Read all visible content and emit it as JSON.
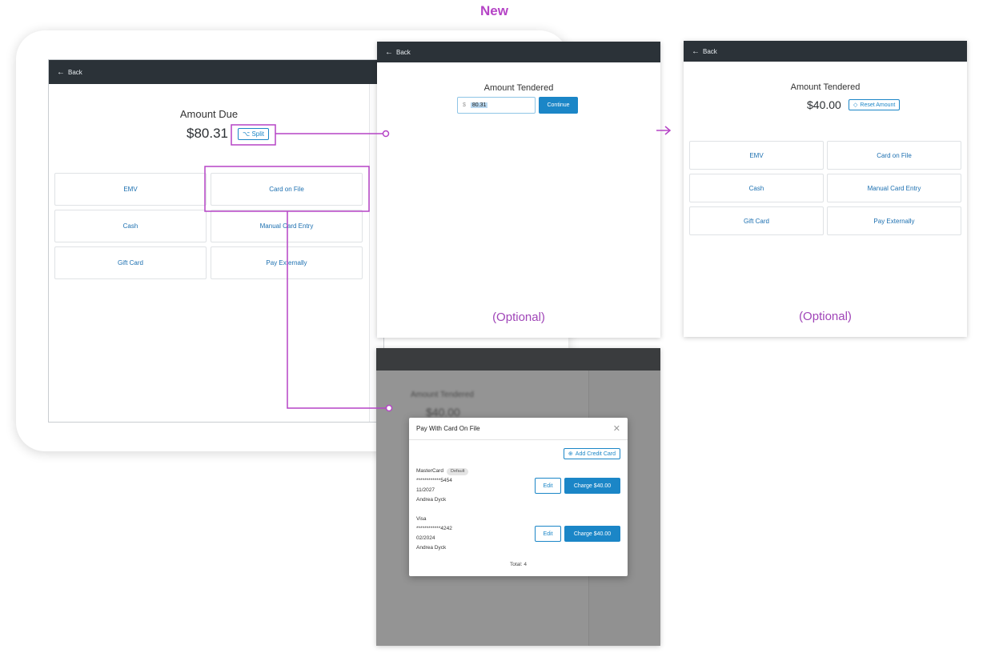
{
  "header": {
    "title": "New"
  },
  "colors": {
    "accent": "#b544c6",
    "primary": "#1b86c7",
    "topbar": "#2b3238"
  },
  "main_screen": {
    "back_label": "Back",
    "amount_due_label": "Amount Due",
    "amount_due_value": "$80.31",
    "split_label": "Split",
    "payment_methods": [
      "EMV",
      "Card on File",
      "Cash",
      "Manual Card Entry",
      "Gift Card",
      "Pay Externally"
    ]
  },
  "tender_panel": {
    "back_label": "Back",
    "title": "Amount Tendered",
    "currency_symbol": "$",
    "input_value": "80.31",
    "continue_label": "Continue",
    "optional_label": "(Optional)"
  },
  "tendered_panel": {
    "back_label": "Back",
    "title": "Amount Tendered",
    "amount": "$40.00",
    "reset_label": "Reset Amount",
    "payment_methods": [
      "EMV",
      "Card on File",
      "Cash",
      "Manual Card Entry",
      "Gift Card",
      "Pay Externally"
    ],
    "optional_label": "(Optional)"
  },
  "card_modal": {
    "background_title": "Amount Tendered",
    "background_amount": "$40.00",
    "title": "Pay With Card On File",
    "add_card_label": "Add Credit Card",
    "cards": [
      {
        "brand": "MasterCard",
        "badge": "Default",
        "number": "************5454",
        "expiry": "11/2027",
        "holder": "Andrea Dyck",
        "edit_label": "Edit",
        "charge_label": "Charge $40.00"
      },
      {
        "brand": "Visa",
        "badge": "",
        "number": "************4242",
        "expiry": "02/2024",
        "holder": "Andrea Dyck",
        "edit_label": "Edit",
        "charge_label": "Charge $40.00"
      }
    ],
    "total_label": "Total: 4"
  },
  "icons": {
    "back": "arrow-left-icon",
    "split": "split-icon",
    "reset": "reset-icon",
    "add": "plus-circle-icon",
    "close": "close-icon",
    "flow": "arrow-right-icon"
  }
}
